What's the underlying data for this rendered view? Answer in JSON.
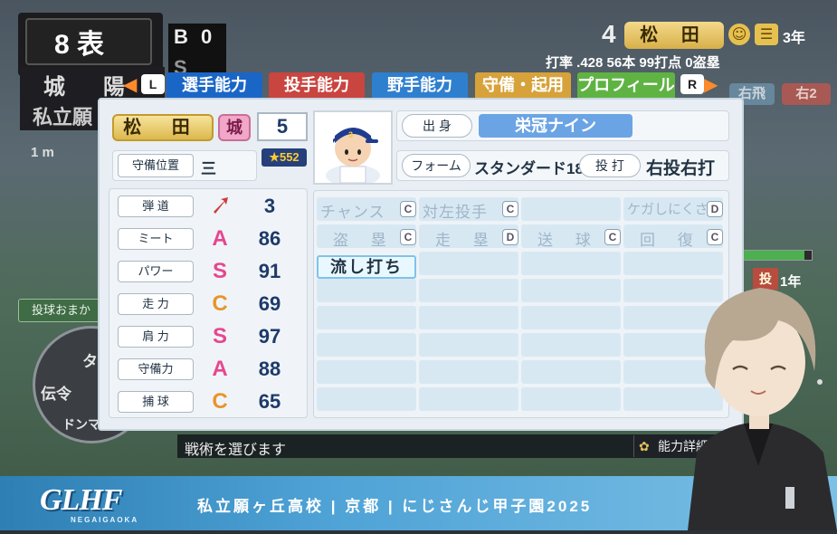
{
  "scoreboard": {
    "inning": "8 表",
    "bso_b": "B",
    "bso_b_count": "0",
    "bso_s": "S",
    "team_home": "城 陽",
    "team_school": "私立願",
    "distance": "1 m"
  },
  "batter_header": {
    "number": "4",
    "name": "松 田",
    "year": "3年",
    "stats": "打率 .428 56本 99打点 0盗塁",
    "face_icon": "face-icon",
    "badge_icon": "speech-icon"
  },
  "badges": {
    "rf": "右飛",
    "r2": "右2"
  },
  "tabs": {
    "left_button": "L",
    "right_button": "R",
    "items": [
      "選手能力",
      "投手能力",
      "野手能力",
      "守備・起用",
      "プロフィール"
    ]
  },
  "player": {
    "name": "松 田",
    "school_icon": "城",
    "number": "5",
    "position_label": "守備位置",
    "position_value": "三",
    "rating": "★552",
    "origin_label": "出 身",
    "origin_value": "栄冠ナイン",
    "form_label": "フォーム",
    "form_value": "スタンダード18",
    "bats_label": "投 打",
    "bats_value": "右投右打"
  },
  "stats": [
    {
      "label": "弾 道",
      "grade": "",
      "value": "3"
    },
    {
      "label": "ミート",
      "grade": "A",
      "value": "86"
    },
    {
      "label": "パワー",
      "grade": "S",
      "value": "91"
    },
    {
      "label": "走 力",
      "grade": "C",
      "value": "69"
    },
    {
      "label": "肩 力",
      "grade": "S",
      "value": "97"
    },
    {
      "label": "守備力",
      "grade": "A",
      "value": "88"
    },
    {
      "label": "捕 球",
      "grade": "C",
      "value": "65"
    }
  ],
  "skills": {
    "row1": [
      "チャンス",
      "対左投手",
      "",
      "ケガしにくさ"
    ],
    "row1_grades": [
      "C",
      "C",
      "",
      "D"
    ],
    "row2": [
      "盗 塁",
      "走 塁",
      "送 球",
      "回 復"
    ],
    "row2_grades": [
      "C",
      "D",
      "C",
      "C"
    ],
    "active": "流し打ち"
  },
  "left_panel": {
    "ctrl_label": "投球おまか",
    "wheel_top": "タ",
    "wheel_left": "伝令",
    "wheel_bottom": "ドンマイ!"
  },
  "prompt": {
    "text": "戦術を選びます",
    "detail": "能力詳細"
  },
  "rank": {
    "badge": "投",
    "year": "1年",
    "gauge_level": 0.9
  },
  "banner": {
    "logo": "GLHF",
    "logo_sub": "NEGAIGAOKA",
    "text": "私立願ヶ丘高校 | 京都 | にじさんじ甲子園2025"
  },
  "colors": {
    "accent_blue": "#1a66c7",
    "grade_A": "#e6478f",
    "grade_S": "#e6478f",
    "grade_C": "#e8952c"
  }
}
